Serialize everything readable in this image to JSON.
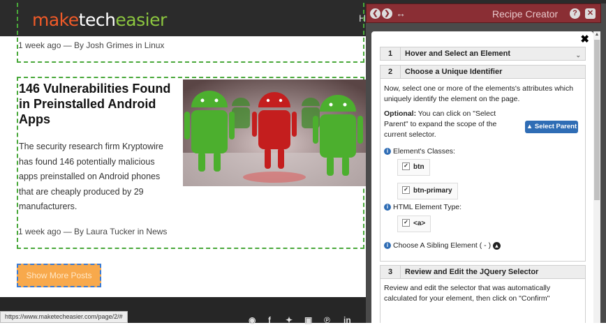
{
  "site": {
    "logo": {
      "part1": "make",
      "part2": "tech",
      "part3": "easier"
    },
    "header_partial": "H",
    "article_prev": {
      "meta": "1 week ago — By Josh Grimes in Linux"
    },
    "article": {
      "title": "146 Vulnerabilities Found in Preinstalled Android Apps",
      "excerpt": "The security research firm Kryptowire has found 146 potentially malicious apps preinstalled on Android phones that are cheaply produced by 29 manufacturers.",
      "meta": "1 week ago — By Laura Tucker in News"
    },
    "show_more": "Show More Posts",
    "status_url": "https://www.maketecheasier.com/page/2/#",
    "social": [
      "rss-icon",
      "facebook-icon",
      "twitter-icon",
      "instagram-icon",
      "pinterest-icon",
      "linkedin-icon"
    ],
    "social_glyphs": {
      "linkedin": "in"
    }
  },
  "panel": {
    "title": "Recipe Creator",
    "help": "?",
    "close": "✕",
    "content_close": "✖",
    "steps": [
      {
        "num": "1",
        "label": "Hover and Select an Element"
      },
      {
        "num": "2",
        "label": "Choose a Unique Identifier"
      },
      {
        "num": "3",
        "label": "Review and Edit the JQuery Selector"
      }
    ],
    "step2": {
      "intro": "Now, select one or more of the elements's attributes which uniquely identify the element on the page.",
      "optional_label": "Optional:",
      "optional_text": " You can click on \"Select Parent\" to expand the scope of the current selector.",
      "select_parent": "Select Parent",
      "classes_label": "Element's Classes:",
      "classes": [
        "btn",
        "btn-primary"
      ],
      "type_label": "HTML Element Type:",
      "element_type": "<a>",
      "sibling_label": "Choose A Sibling Element ( - )"
    },
    "step3": {
      "text": "Review and edit the selector that was automatically calculated for your element, then click on \"Confirm\""
    }
  },
  "colors": {
    "titlebar": "#8a2e34",
    "logo_make": "#f05a28",
    "logo_easier": "#8cc63f",
    "selection_outline": "#49a83a",
    "button_blue": "#2f6db5",
    "show_more_bg": "#f8a94c"
  }
}
